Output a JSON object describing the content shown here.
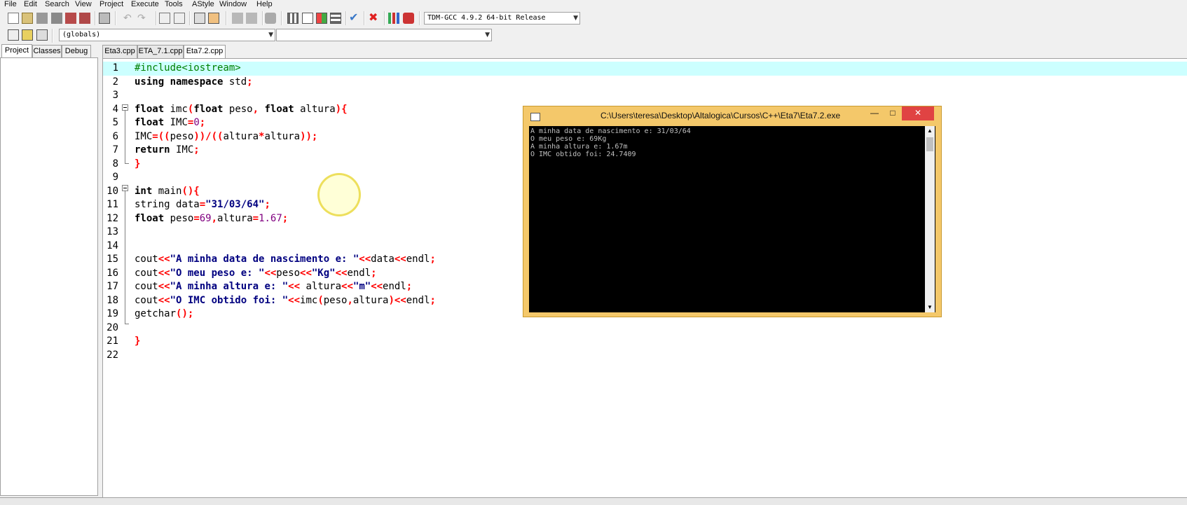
{
  "menu": [
    "File",
    "Edit",
    "Search",
    "View",
    "Project",
    "Execute",
    "Tools",
    "AStyle",
    "Window",
    "Help"
  ],
  "toolbar": {
    "compiler": "TDM-GCC 4.9.2 64-bit Release",
    "scope": "(globals)",
    "member": ""
  },
  "left_tabs": [
    "Project",
    "Classes",
    "Debug"
  ],
  "editor_tabs": [
    "Eta3.cpp",
    "ETA_7.1.cpp",
    "Eta7.2.cpp"
  ],
  "editor": {
    "active_tab": "Eta7.2.cpp",
    "line_numbers": [
      "1",
      "2",
      "3",
      "4",
      "5",
      "6",
      "7",
      "8",
      "9",
      "10",
      "11",
      "12",
      "13",
      "14",
      "15",
      "16",
      "17",
      "18",
      "19",
      "20",
      "21",
      "22"
    ]
  },
  "console": {
    "title": "C:\\Users\\teresa\\Desktop\\Altalogica\\Cursos\\C++\\Eta7\\Eta7.2.exe",
    "lines": [
      "A minha data de nascimento e: 31/03/64",
      "O meu peso e: 69Kg",
      "A minha altura e: 1.67m",
      "O IMC obtido foi: 24.7409"
    ],
    "minimize": "—",
    "maximize": "□",
    "close": "✕"
  },
  "colors": {
    "highlight_line": "#ccffff",
    "console_frame": "#f4c86a",
    "close_button": "#e04343"
  }
}
